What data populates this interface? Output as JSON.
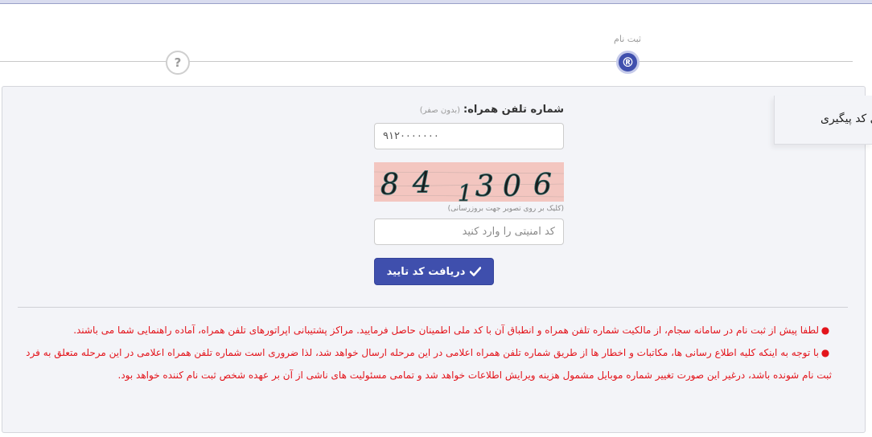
{
  "stepper": {
    "step1_label": "ثبت نام",
    "step1_icon": "®",
    "step2_icon": "?"
  },
  "form": {
    "phone_label": "شماره تلفن همراه:",
    "phone_hint": "(بدون صفر)",
    "phone_value": "۹۱۲۰۰۰۰۰۰۰",
    "captcha_text": "841306",
    "captcha_hint": "(کلیک بر روی تصویر جهت بروزرسانی)",
    "captcha_placeholder": "کد امنیتی را وارد کنید",
    "submit_label": "دریافت کد تایید"
  },
  "notices": [
    "لطفا پیش از ثبت نام در سامانه سجام، از مالکیت شماره تلفن همراه و انطباق آن با کد ملی اطمینان حاصل فرمایید. مراکز پشتیبانی اپراتورهای تلفن همراه، آماده راهنمایی شما می باشند.",
    "با توجه به اینکه کلیه اطلاع رسانی ها، مکاتبات و اخطار ها از طریق شماره تلفن همراه اعلامی در این مرحله ارسال خواهد شد، لذا ضروری است شماره تلفن همراه اعلامی در این مرحله متعلق به فرد ثبت نام شونده باشد، درغیر این صورت تغییر شماره موبایل مشمول هزینه ویرایش اطلاعات خواهد شد و تمامی مسئولیت های ناشی از آن بر عهده شخص ثبت نام کننده خواهد بود."
  ],
  "tracking_tab_label": "ی کد پیگیری",
  "colors": {
    "primary": "#3f4fad",
    "notice_red": "#e3141b",
    "captcha_bg": "#f3c6c0",
    "panel_bg": "#f3f4f8"
  }
}
